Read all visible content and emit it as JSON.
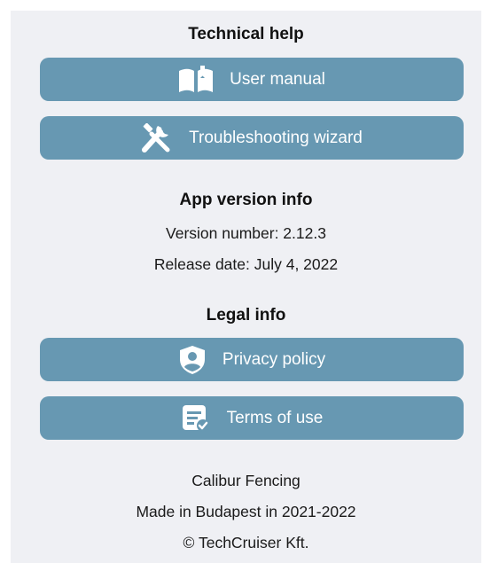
{
  "technical_help": {
    "title": "Technical help",
    "buttons": [
      {
        "label": "User manual",
        "icon": "book-icon"
      },
      {
        "label": "Troubleshooting wizard",
        "icon": "tools-icon"
      }
    ]
  },
  "app_version": {
    "title": "App version info",
    "version_text": "Version number: 2.12.3",
    "release_text": "Release date: July 4, 2022"
  },
  "legal_info": {
    "title": "Legal info",
    "buttons": [
      {
        "label": "Privacy policy",
        "icon": "shield-user-icon"
      },
      {
        "label": "Terms of use",
        "icon": "document-check-icon"
      }
    ]
  },
  "footer": {
    "company": "Calibur Fencing",
    "made_in": "Made in Budapest in 2021-2022",
    "copyright": "© TechCruiser Kft."
  },
  "colors": {
    "button_bg": "#6798b2",
    "panel_bg": "#eff0f4",
    "button_text": "#ffffff"
  }
}
